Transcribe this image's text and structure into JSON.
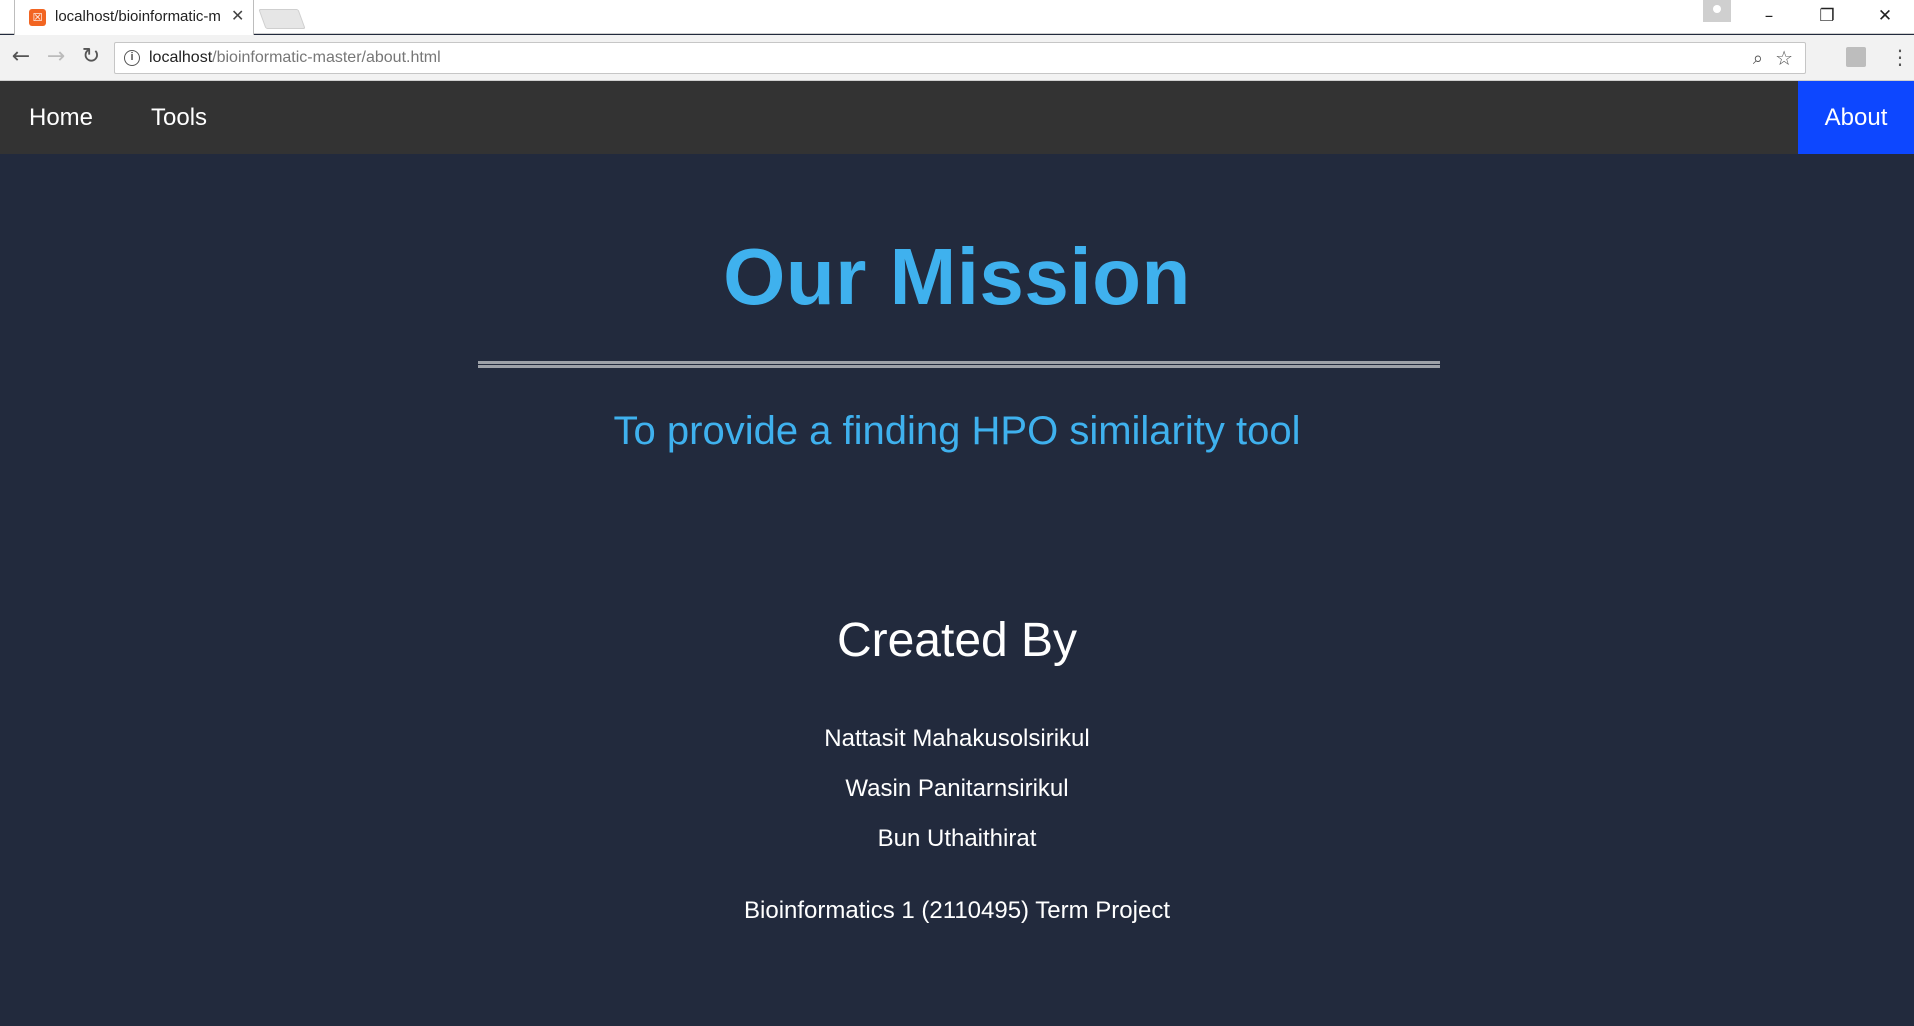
{
  "browser": {
    "tab_title": "localhost/bioinformatic-m",
    "tab_favicon": "xampp-icon",
    "url_host": "localhost",
    "url_path": "/bioinformatic-master/about.html"
  },
  "nav": {
    "items": [
      {
        "label": "Home"
      },
      {
        "label": "Tools"
      },
      {
        "label": "About",
        "active": true
      }
    ],
    "active_color": "#0d47ff"
  },
  "mission": {
    "title": "Our Mission",
    "text": "To provide a finding HPO similarity tool",
    "accent_color": "#3fb1ee"
  },
  "credits": {
    "title": "Created By",
    "authors": [
      "Nattasit Mahakusolsirikul",
      "Wasin Panitarnsirikul",
      "Bun Uthaithirat"
    ],
    "course": "Bioinformatics 1 (2110495) Term Project"
  }
}
